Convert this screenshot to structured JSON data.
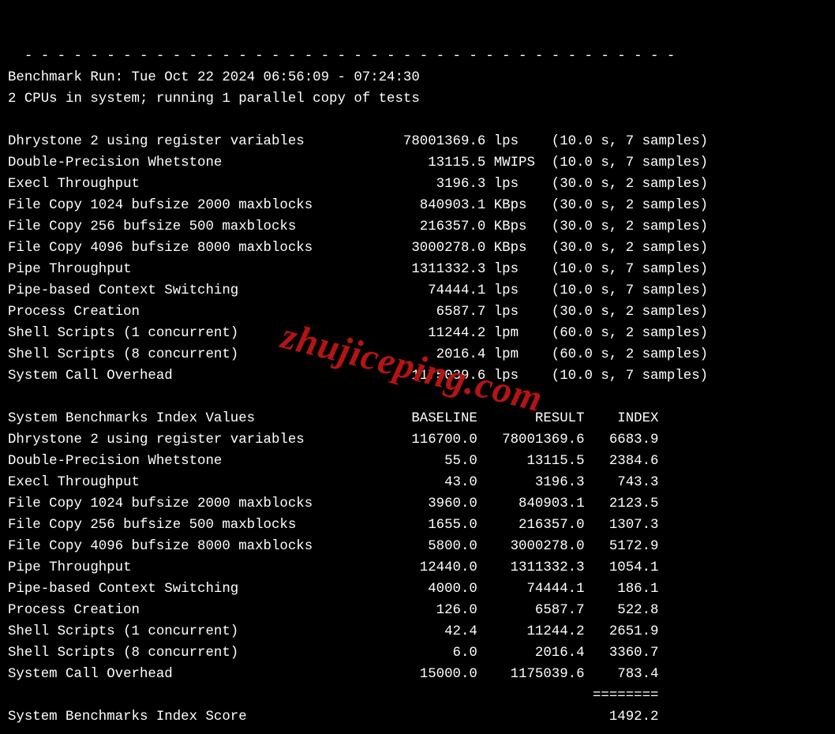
{
  "dashes": "- - - - - - - - - - - - - - - - - - - - - - - - - - - - - - - - - - - - - - - -",
  "header": {
    "run_line": "Benchmark Run: Tue Oct 22 2024 06:56:09 - 07:24:30",
    "cpu_line": "2 CPUs in system; running 1 parallel copy of tests"
  },
  "tests": [
    {
      "name": "Dhrystone 2 using register variables",
      "value": "78001369.6",
      "unit": "lps",
      "dur": "10.0",
      "samp": "7"
    },
    {
      "name": "Double-Precision Whetstone",
      "value": "13115.5",
      "unit": "MWIPS",
      "dur": "10.0",
      "samp": "7"
    },
    {
      "name": "Execl Throughput",
      "value": "3196.3",
      "unit": "lps",
      "dur": "30.0",
      "samp": "2"
    },
    {
      "name": "File Copy 1024 bufsize 2000 maxblocks",
      "value": "840903.1",
      "unit": "KBps",
      "dur": "30.0",
      "samp": "2"
    },
    {
      "name": "File Copy 256 bufsize 500 maxblocks",
      "value": "216357.0",
      "unit": "KBps",
      "dur": "30.0",
      "samp": "2"
    },
    {
      "name": "File Copy 4096 bufsize 8000 maxblocks",
      "value": "3000278.0",
      "unit": "KBps",
      "dur": "30.0",
      "samp": "2"
    },
    {
      "name": "Pipe Throughput",
      "value": "1311332.3",
      "unit": "lps",
      "dur": "10.0",
      "samp": "7"
    },
    {
      "name": "Pipe-based Context Switching",
      "value": "74444.1",
      "unit": "lps",
      "dur": "10.0",
      "samp": "7"
    },
    {
      "name": "Process Creation",
      "value": "6587.7",
      "unit": "lps",
      "dur": "30.0",
      "samp": "2"
    },
    {
      "name": "Shell Scripts (1 concurrent)",
      "value": "11244.2",
      "unit": "lpm",
      "dur": "60.0",
      "samp": "2"
    },
    {
      "name": "Shell Scripts (8 concurrent)",
      "value": "2016.4",
      "unit": "lpm",
      "dur": "60.0",
      "samp": "2"
    },
    {
      "name": "System Call Overhead",
      "value": "1175039.6",
      "unit": "lps",
      "dur": "10.0",
      "samp": "7"
    }
  ],
  "index": {
    "header": {
      "title": "System Benchmarks Index Values",
      "c1": "BASELINE",
      "c2": "RESULT",
      "c3": "INDEX"
    },
    "rows": [
      {
        "name": "Dhrystone 2 using register variables",
        "baseline": "116700.0",
        "result": "78001369.6",
        "index": "6683.9"
      },
      {
        "name": "Double-Precision Whetstone",
        "baseline": "55.0",
        "result": "13115.5",
        "index": "2384.6"
      },
      {
        "name": "Execl Throughput",
        "baseline": "43.0",
        "result": "3196.3",
        "index": "743.3"
      },
      {
        "name": "File Copy 1024 bufsize 2000 maxblocks",
        "baseline": "3960.0",
        "result": "840903.1",
        "index": "2123.5"
      },
      {
        "name": "File Copy 256 bufsize 500 maxblocks",
        "baseline": "1655.0",
        "result": "216357.0",
        "index": "1307.3"
      },
      {
        "name": "File Copy 4096 bufsize 8000 maxblocks",
        "baseline": "5800.0",
        "result": "3000278.0",
        "index": "5172.9"
      },
      {
        "name": "Pipe Throughput",
        "baseline": "12440.0",
        "result": "1311332.3",
        "index": "1054.1"
      },
      {
        "name": "Pipe-based Context Switching",
        "baseline": "4000.0",
        "result": "74444.1",
        "index": "186.1"
      },
      {
        "name": "Process Creation",
        "baseline": "126.0",
        "result": "6587.7",
        "index": "522.8"
      },
      {
        "name": "Shell Scripts (1 concurrent)",
        "baseline": "42.4",
        "result": "11244.2",
        "index": "2651.9"
      },
      {
        "name": "Shell Scripts (8 concurrent)",
        "baseline": "6.0",
        "result": "2016.4",
        "index": "3360.7"
      },
      {
        "name": "System Call Overhead",
        "baseline": "15000.0",
        "result": "1175039.6",
        "index": "783.4"
      }
    ],
    "sep": "========",
    "score_label": "System Benchmarks Index Score",
    "score_value": "1492.2"
  },
  "watermark": "zhujiceping.com"
}
